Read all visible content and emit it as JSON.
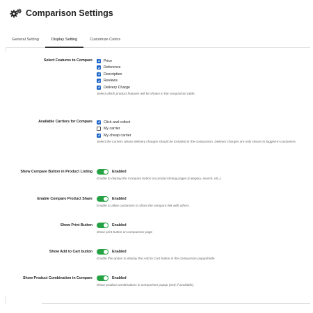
{
  "header": {
    "title": "Comparison Settings",
    "icon": "gears-icon"
  },
  "tabs": [
    {
      "label": "General Setting",
      "active": false
    },
    {
      "label": "Display Setting",
      "active": true
    },
    {
      "label": "Customize Colors",
      "active": false
    }
  ],
  "features": {
    "label": "Select Features to Compare",
    "options": [
      {
        "label": "Price",
        "checked": true
      },
      {
        "label": "Reference",
        "checked": true
      },
      {
        "label": "Description",
        "checked": true
      },
      {
        "label": "Reviews",
        "checked": true
      },
      {
        "label": "Delivery Charge",
        "checked": true
      }
    ],
    "help": "Select which product features will be shown in the comparison table."
  },
  "carriers": {
    "label": "Available Carriers for Compare",
    "options": [
      {
        "label": "Click and collect",
        "checked": true
      },
      {
        "label": "My carrier",
        "checked": false
      },
      {
        "label": "My cheap carrier",
        "checked": true
      }
    ],
    "help": "Select the carriers whose delivery charges should be included in the comparison. Delivery charges are only shown to logged-in customers."
  },
  "toggles": [
    {
      "label": "Show Compare Button in Product Listing",
      "state": "Enabled",
      "help": "Enable to display the Compare button on product listing pages (category, search, etc.)."
    },
    {
      "label": "Enable Compare Product Share",
      "state": "Enabled",
      "help": "Enable to allow customers to share the compare link with others."
    },
    {
      "label": "Show Print Button",
      "state": "Enabled",
      "help": "Show print button on comparison page"
    },
    {
      "label": "Show Add to Cart button",
      "state": "Enabled",
      "help": "Enable this option to display the Add to Cart button in the comparison popup/table"
    },
    {
      "label": "Show Product Combination in Compare",
      "state": "Enabled",
      "help": "Show product combinations in comparison popup (only if available)."
    }
  ],
  "colors": {
    "accent": "#1f66c9",
    "toggle_on": "#25a244"
  }
}
